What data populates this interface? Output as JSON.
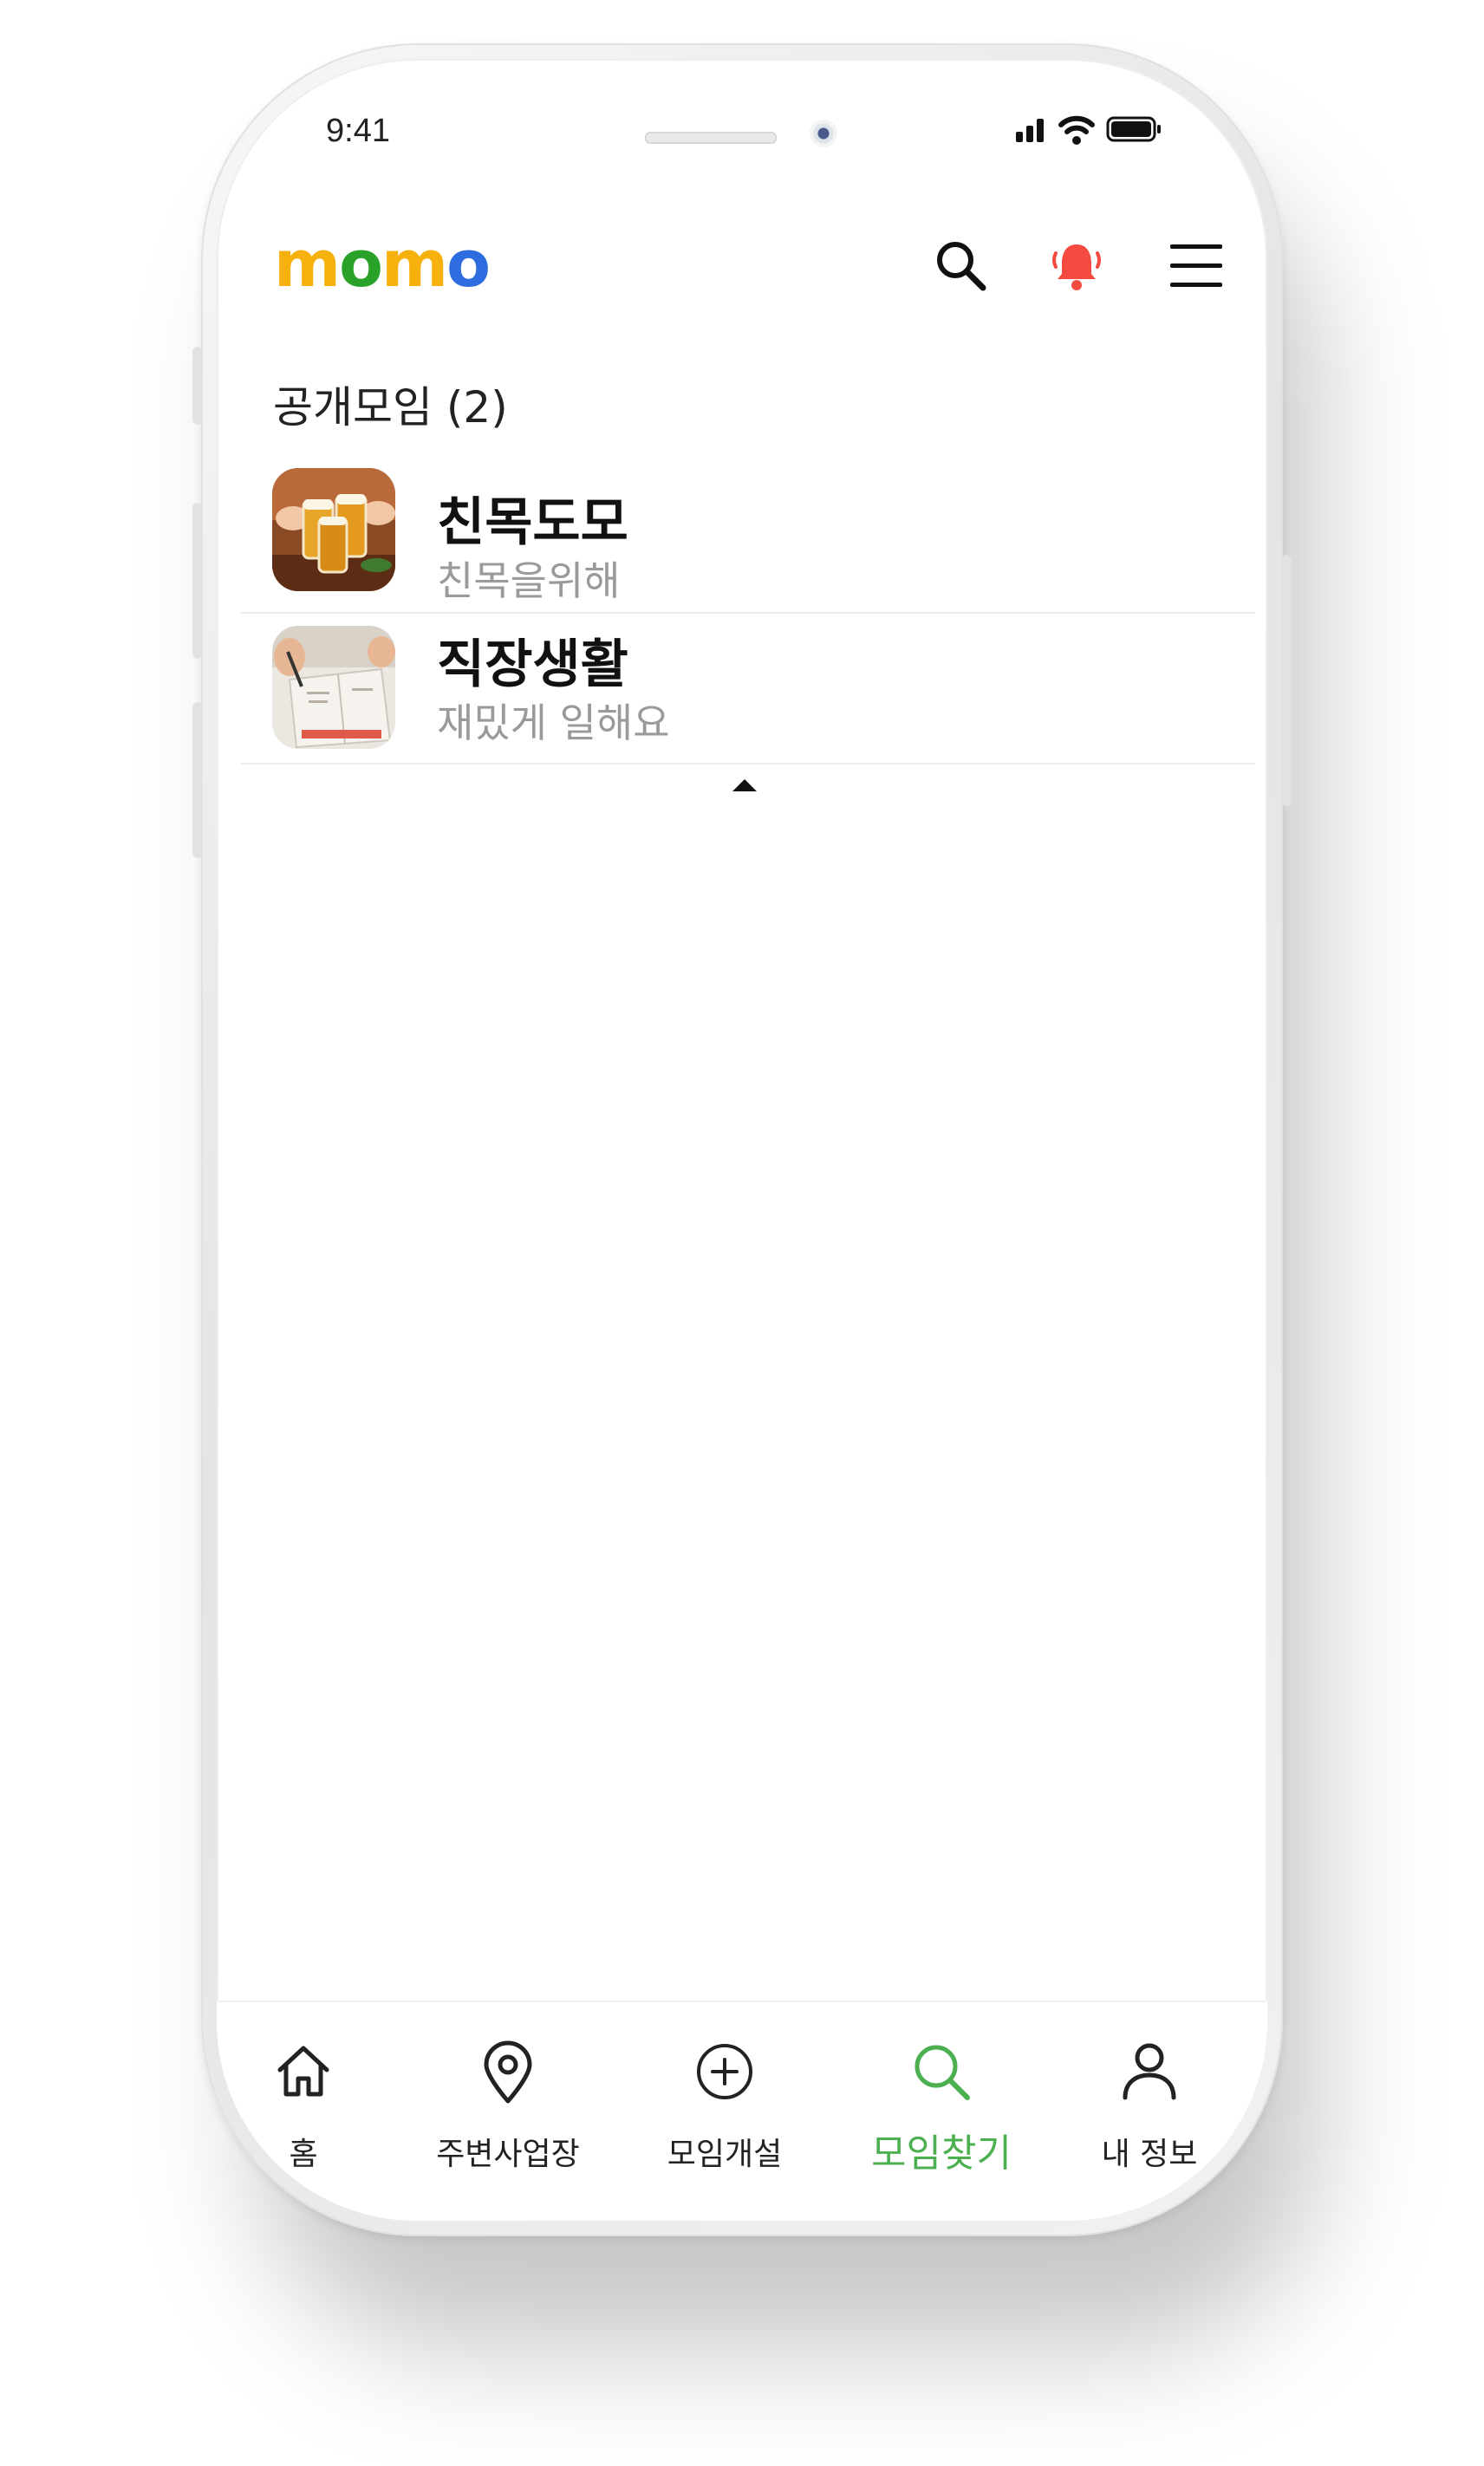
{
  "status_bar": {
    "time": "9:41"
  },
  "header": {
    "logo": [
      "m",
      "o",
      "m",
      "o"
    ],
    "logo_colors": [
      "#f6b10c",
      "#2aa22a",
      "#f6b10c",
      "#2d6de0"
    ],
    "alert_color": "#f44a3f"
  },
  "section": {
    "title": "공개모임 (2)"
  },
  "groups": [
    {
      "name": "친목도모",
      "description": "친목을위해",
      "thumbnail": "beer-glasses-photo"
    },
    {
      "name": "직장생활",
      "description": "재밌게 일해요",
      "thumbnail": "office-notebook-photo"
    }
  ],
  "bottom_nav": {
    "active_color": "#4caf50",
    "items": [
      {
        "label": "홈",
        "icon": "home-icon"
      },
      {
        "label": "주변사업장",
        "icon": "location-pin-icon"
      },
      {
        "label": "모임개설",
        "icon": "plus-circle-icon"
      },
      {
        "label": "모임찾기",
        "icon": "search-icon",
        "active": true
      },
      {
        "label": "내 정보",
        "icon": "user-icon"
      }
    ]
  }
}
